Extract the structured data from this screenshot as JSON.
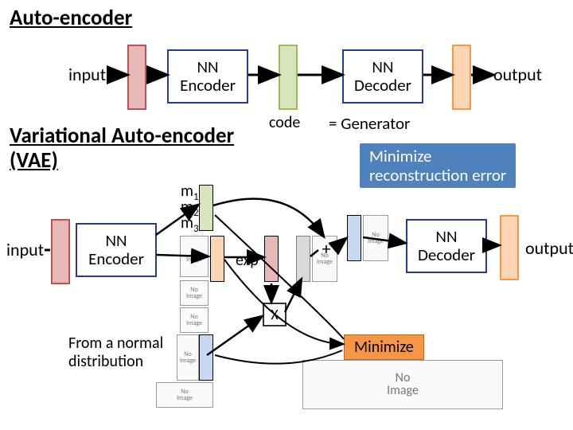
{
  "titles": {
    "ae": "Auto-encoder",
    "vae": "Variational Auto-encoder\n(VAE)"
  },
  "common": {
    "input": "input",
    "output": "output",
    "nn_encoder": "NN\nEncoder",
    "nn_decoder": "NN\nDecoder",
    "code": "code",
    "eq_gen": "= Generator"
  },
  "annot": {
    "recon": "Minimize\nreconstruction error",
    "min": "Minimize",
    "from_normal": "From a normal\ndistribution"
  },
  "math": {
    "m1": "m",
    "m1s": "1",
    "m2": "m",
    "m2s": "2",
    "m3": "m",
    "m3s": "3",
    "exp": "exp",
    "plus": "+",
    "mult": "X"
  },
  "placeholder": "No\nImage"
}
